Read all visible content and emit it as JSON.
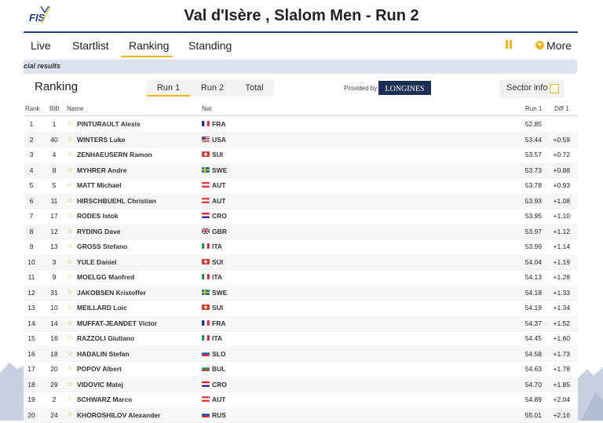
{
  "header": {
    "title": "Val d'Isère , Slalom Men - Run 2",
    "logo_text": "FIS"
  },
  "nav": {
    "tabs": [
      {
        "label": "Live"
      },
      {
        "label": "Startlist"
      },
      {
        "label": "Ranking"
      },
      {
        "label": "Standing"
      }
    ],
    "active_tab": "Ranking",
    "pause_icon": "pause-icon",
    "more_label": "More"
  },
  "banner": {
    "text": "cial results"
  },
  "ranking": {
    "title": "Ranking",
    "run_tabs": [
      {
        "label": "Run 1"
      },
      {
        "label": "Run 2"
      },
      {
        "label": "Total"
      }
    ],
    "active_run_tab": "Run 1",
    "provided_by": "Provided by",
    "sponsor": "LONGINES",
    "sector_info_label": "Sector info"
  },
  "table": {
    "columns": {
      "rank": "Rank",
      "bib": "BIB",
      "name": "Name",
      "nat": "Nat",
      "run1": "Run 1",
      "diff1": "Diff 1"
    },
    "rows": [
      {
        "rank": "1",
        "bib": "1",
        "name": "PINTURAULT Alexis",
        "nat": "FRA",
        "run1": "52.85",
        "diff": ""
      },
      {
        "rank": "2",
        "bib": "40",
        "name": "WINTERS Luke",
        "nat": "USA",
        "run1": "53.44",
        "diff": "+0.59"
      },
      {
        "rank": "3",
        "bib": "4",
        "name": "ZENHAEUSERN Ramon",
        "nat": "SUI",
        "run1": "53.57",
        "diff": "+0.72"
      },
      {
        "rank": "4",
        "bib": "8",
        "name": "MYHRER Andre",
        "nat": "SWE",
        "run1": "53.73",
        "diff": "+0.88"
      },
      {
        "rank": "5",
        "bib": "5",
        "name": "MATT Michael",
        "nat": "AUT",
        "run1": "53.78",
        "diff": "+0.93"
      },
      {
        "rank": "6",
        "bib": "11",
        "name": "HIRSCHBUEHL Christian",
        "nat": "AUT",
        "run1": "53.93",
        "diff": "+1.08"
      },
      {
        "rank": "7",
        "bib": "17",
        "name": "RODES Istok",
        "nat": "CRO",
        "run1": "53.95",
        "diff": "+1.10"
      },
      {
        "rank": "8",
        "bib": "12",
        "name": "RYDING Dave",
        "nat": "GBR",
        "run1": "53.97",
        "diff": "+1.12"
      },
      {
        "rank": "9",
        "bib": "13",
        "name": "GROSS Stefano",
        "nat": "ITA",
        "run1": "53.99",
        "diff": "+1.14"
      },
      {
        "rank": "10",
        "bib": "3",
        "name": "YULE Daniel",
        "nat": "SUI",
        "run1": "54.04",
        "diff": "+1.19"
      },
      {
        "rank": "11",
        "bib": "9",
        "name": "MOELGG Manfred",
        "nat": "ITA",
        "run1": "54.13",
        "diff": "+1.28"
      },
      {
        "rank": "12",
        "bib": "31",
        "name": "JAKOBSEN Kristoffer",
        "nat": "SWE",
        "run1": "54.18",
        "diff": "+1.33"
      },
      {
        "rank": "13",
        "bib": "10",
        "name": "MEILLARD Loic",
        "nat": "SUI",
        "run1": "54.19",
        "diff": "+1.34"
      },
      {
        "rank": "14",
        "bib": "14",
        "name": "MUFFAT-JEANDET Victor",
        "nat": "FRA",
        "run1": "54.37",
        "diff": "+1.52"
      },
      {
        "rank": "15",
        "bib": "16",
        "name": "RAZZOLI Giuliano",
        "nat": "ITA",
        "run1": "54.45",
        "diff": "+1.60"
      },
      {
        "rank": "16",
        "bib": "18",
        "name": "HADALIN Stefan",
        "nat": "SLO",
        "run1": "54.58",
        "diff": "+1.73"
      },
      {
        "rank": "17",
        "bib": "20",
        "name": "POPOV Albert",
        "nat": "BUL",
        "run1": "54.63",
        "diff": "+1.78"
      },
      {
        "rank": "18",
        "bib": "29",
        "name": "VIDOVIC Matej",
        "nat": "CRO",
        "run1": "54.70",
        "diff": "+1.85"
      },
      {
        "rank": "19",
        "bib": "2",
        "name": "SCHWARZ Marco",
        "nat": "AUT",
        "run1": "54.89",
        "diff": "+2.04"
      },
      {
        "rank": "20",
        "bib": "24",
        "name": "KHOROSHILOV Alexander",
        "nat": "RUS",
        "run1": "55.01",
        "diff": "+2.16"
      }
    ]
  },
  "flag_colors": {
    "FRA": [
      "#002395",
      "#ffffff",
      "#ed2939"
    ],
    "USA": [
      "#b22234",
      "#ffffff",
      "#3c3b6e"
    ],
    "SUI": [
      "#d52b1e",
      "#ffffff"
    ],
    "SWE": [
      "#006aa7",
      "#fecc00"
    ],
    "AUT": [
      "#ed2939",
      "#ffffff",
      "#ed2939"
    ],
    "CRO": [
      "#ff0000",
      "#ffffff",
      "#171796"
    ],
    "GBR": [
      "#012169",
      "#ffffff",
      "#c8102e"
    ],
    "ITA": [
      "#009246",
      "#ffffff",
      "#ce2b37"
    ],
    "SLO": [
      "#ffffff",
      "#005da4",
      "#ed1c24"
    ],
    "BUL": [
      "#ffffff",
      "#00966e",
      "#d62612"
    ],
    "RUS": [
      "#ffffff",
      "#0039a6",
      "#d52b1e"
    ]
  },
  "colors": {
    "accent": "#e8b923",
    "brand_blue": "#1f3c8c",
    "banner_bg": "#dde3ee"
  }
}
